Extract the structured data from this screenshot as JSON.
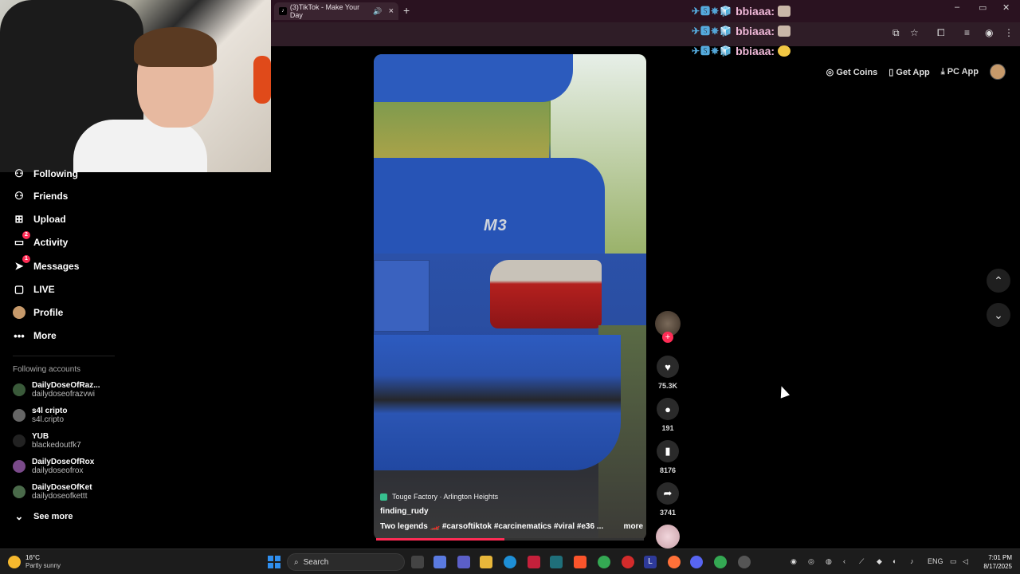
{
  "browser": {
    "tab_title": "(3)TikTok - Make Your Day",
    "tab_close": "×",
    "new_tab": "+",
    "window_controls": [
      "–",
      "▭",
      "✕"
    ]
  },
  "chat": [
    {
      "user": "bbiaaa:",
      "badges": "✈🆂✵🧊"
    },
    {
      "user": "bbiaaa:",
      "badges": "✈🆂✵🧊"
    },
    {
      "user": "bbiaaa:",
      "badges": "✈🆂✵🧊"
    }
  ],
  "header": {
    "get_coins": "Get Coins",
    "get_app": "Get App",
    "pc_app": "PC App"
  },
  "sidebar": {
    "items": [
      {
        "label": "Following",
        "icon": "users-icon"
      },
      {
        "label": "Friends",
        "icon": "friends-icon"
      },
      {
        "label": "Upload",
        "icon": "upload-icon"
      },
      {
        "label": "Activity",
        "icon": "activity-icon",
        "badge": "2"
      },
      {
        "label": "Messages",
        "icon": "messages-icon",
        "badge": "1"
      },
      {
        "label": "LIVE",
        "icon": "live-icon"
      },
      {
        "label": "Profile",
        "icon": "profile-icon"
      },
      {
        "label": "More",
        "icon": "more-icon"
      }
    ],
    "following_title": "Following accounts",
    "accounts": [
      {
        "name": "DailyDoseOfRaz...",
        "handle": "dailydoseofrazvwi"
      },
      {
        "name": "s4l cripto",
        "handle": "s4l.cripto"
      },
      {
        "name": "YUB",
        "handle": "blackedoutfk7"
      },
      {
        "name": "DailyDoseOfRox",
        "handle": "dailydoseofrox"
      },
      {
        "name": "DailyDoseOfKet",
        "handle": "dailydoseofkettt"
      }
    ],
    "see_more": "See more"
  },
  "video": {
    "badge_text": "M3",
    "location": "Touge Factory · Arlington Heights",
    "author": "finding_rudy",
    "description": "Two legends 🏎️ #carsoftiktok #carcinematics #viral #e36 ...",
    "more": "more",
    "progress": 0.48
  },
  "actions": {
    "likes": "75.3K",
    "comments": "191",
    "saves": "8176",
    "shares": "3741"
  },
  "taskbar": {
    "temperature": "16°C",
    "weather": "Partly sunny",
    "search": "Search",
    "lang": "ENG",
    "time": "7:01 PM",
    "date": "8/17/2025"
  }
}
